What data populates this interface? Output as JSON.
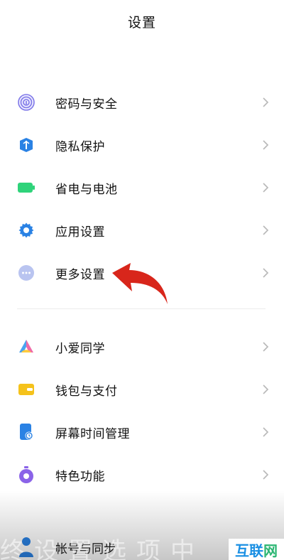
{
  "header": {
    "title": "设置"
  },
  "group1": [
    {
      "label": "密码与安全",
      "icon": "fingerprint-icon"
    },
    {
      "label": "隐私保护",
      "icon": "shield-icon"
    },
    {
      "label": "省电与电池",
      "icon": "battery-icon"
    },
    {
      "label": "应用设置",
      "icon": "gear-icon"
    },
    {
      "label": "更多设置",
      "icon": "more-dots-icon"
    }
  ],
  "group2": [
    {
      "label": "小爱同学",
      "icon": "xiaoai-icon"
    },
    {
      "label": "钱包与支付",
      "icon": "wallet-icon"
    },
    {
      "label": "屏幕时间管理",
      "icon": "screen-time-icon"
    },
    {
      "label": "特色功能",
      "icon": "feature-icon"
    }
  ],
  "bottom": {
    "label": "帐号与同步",
    "icon": "account-icon"
  },
  "watermark": {
    "big": "终设置选项中",
    "logo_a": "互联",
    "logo_b": "网"
  },
  "colors": {
    "accent": "#2a82e4",
    "arrow": "#d8261b"
  }
}
